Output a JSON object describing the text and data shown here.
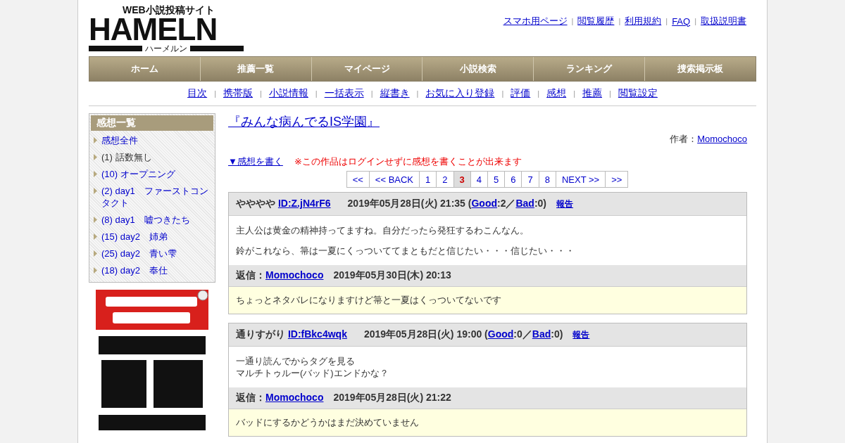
{
  "logo": {
    "title": "HAMELN",
    "tagline": "WEB小説投稿サイト",
    "reading": "ハーメルン"
  },
  "top_links": [
    {
      "kind": "link",
      "label": "スマホ用ページ"
    },
    {
      "kind": "separator",
      "label": "|"
    },
    {
      "kind": "link",
      "label": "閲覧履歴"
    },
    {
      "kind": "separator",
      "label": "|"
    },
    {
      "kind": "link",
      "label": "利用規約"
    },
    {
      "kind": "separator",
      "label": "|"
    },
    {
      "kind": "link",
      "label": "FAQ"
    },
    {
      "kind": "separator",
      "label": "|"
    },
    {
      "kind": "link",
      "label": "取扱説明書"
    }
  ],
  "nav": [
    "ホーム",
    "推薦一覧",
    "マイページ",
    "小説検索",
    "ランキング",
    "捜索掲示板"
  ],
  "sub_links": [
    {
      "kind": "link",
      "label": "目次"
    },
    {
      "kind": "separator",
      "label": "|"
    },
    {
      "kind": "link",
      "label": "携帯版"
    },
    {
      "kind": "separator",
      "label": "|"
    },
    {
      "kind": "link",
      "label": "小説情報"
    },
    {
      "kind": "separator",
      "label": "|"
    },
    {
      "kind": "link",
      "label": "一括表示"
    },
    {
      "kind": "separator",
      "label": "|"
    },
    {
      "kind": "link",
      "label": "縦書き"
    },
    {
      "kind": "separator",
      "label": "|"
    },
    {
      "kind": "link",
      "label": "お気に入り登録"
    },
    {
      "kind": "separator",
      "label": "|"
    },
    {
      "kind": "link",
      "label": "評価"
    },
    {
      "kind": "separator",
      "label": "|"
    },
    {
      "kind": "link",
      "label": "感想"
    },
    {
      "kind": "separator",
      "label": "|"
    },
    {
      "kind": "link",
      "label": "推薦"
    },
    {
      "kind": "separator",
      "label": "|"
    },
    {
      "kind": "link",
      "label": "閲覧設定"
    }
  ],
  "sidebar": {
    "title": "感想一覧",
    "items": [
      {
        "label": "感想全件",
        "link": true
      },
      {
        "label": "(1) 話数無し",
        "link": false
      },
      {
        "label": "(10) オープニング",
        "link": true
      },
      {
        "label": "(2) day1　ファーストコンタクト",
        "link": true
      },
      {
        "label": "(8) day1　嘘つきたち",
        "link": true
      },
      {
        "label": "(15) day2　姉弟",
        "link": true
      },
      {
        "label": "(25) day2　青い雫",
        "link": true
      },
      {
        "label": "(18) day2　奉仕",
        "link": true
      }
    ]
  },
  "novel_title": "『みんな病んでるIS学園』",
  "author": {
    "label": "作者：",
    "name": "Momochoco"
  },
  "write_link": "▼感想を書く",
  "notice": "※この作品はログインせずに感想を書くことが出来ます",
  "pagination": [
    {
      "label": "<<",
      "selected": false
    },
    {
      "label": "<< BACK",
      "selected": false
    },
    {
      "label": "1",
      "selected": false
    },
    {
      "label": "2",
      "selected": false
    },
    {
      "label": "3",
      "selected": true
    },
    {
      "label": "4",
      "selected": false
    },
    {
      "label": "5",
      "selected": false
    },
    {
      "label": "6",
      "selected": false
    },
    {
      "label": "7",
      "selected": false
    },
    {
      "label": "8",
      "selected": false
    },
    {
      "label": "NEXT >>",
      "selected": false
    },
    {
      "label": ">>",
      "selected": false
    }
  ],
  "comments": [
    {
      "author": "やややや",
      "id": "ID:Z.jN4rF6",
      "meta": [
        {
          "text": "2019年05月28日(火) 21:35 ("
        },
        {
          "link": "Good"
        },
        {
          "text": ":2／"
        },
        {
          "link": "Bad"
        },
        {
          "text": ":0)"
        }
      ],
      "report": "報告",
      "paragraphs": [
        [
          "主人公は黄金の精神持ってますね。自分だったら発狂するわこんなん。"
        ],
        [
          "鈴がこれなら、箒は一夏にくっついててまともだと信じたい・・・信じたい・・・"
        ]
      ],
      "reply": {
        "label": "返信：",
        "name": "Momochoco",
        "date": "2019年05月30日(木) 20:13",
        "text": "ちょっとネタバレになりますけど箒と一夏はくっついてないです"
      }
    },
    {
      "author": "通りすがり",
      "id": "ID:fBkc4wqk",
      "meta": [
        {
          "text": "2019年05月28日(火) 19:00 ("
        },
        {
          "link": "Good"
        },
        {
          "text": ":0／"
        },
        {
          "link": "Bad"
        },
        {
          "text": ":0)"
        }
      ],
      "report": "報告",
      "paragraphs": [
        [
          "一通り読んでからタグを見る",
          "マルチトゥルー(バッド)エンドかな？"
        ]
      ],
      "reply": {
        "label": "返信：",
        "name": "Momochoco",
        "date": "2019年05月28日(火) 21:22",
        "text": "バッドにするかどうかはまだ決めていません"
      }
    }
  ]
}
